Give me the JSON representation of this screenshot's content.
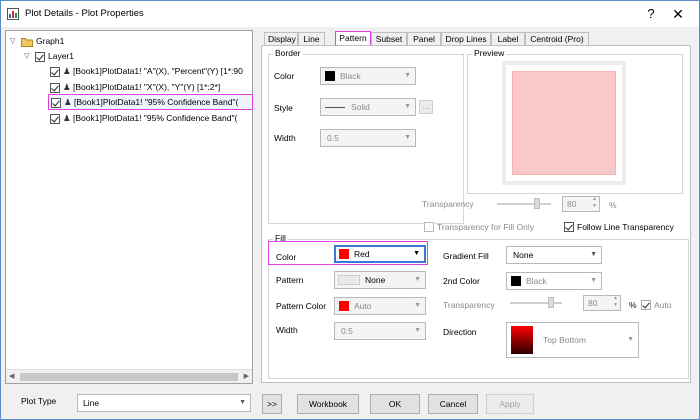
{
  "window": {
    "title": "Plot Details - Plot Properties",
    "help_glyph": "?",
    "close_glyph": "✕"
  },
  "tree": {
    "nodes": [
      {
        "label": "Graph1",
        "icon": "folder-icon",
        "checked": null,
        "expanded": true
      },
      {
        "label": "Layer1",
        "checked": true,
        "expanded": true
      },
      {
        "label": "[Book1]PlotData1! \"A\"(X), \"Percent\"(Y) [1*:90",
        "checked": true
      },
      {
        "label": "[Book1]PlotData1! \"X\"(X), \"Y\"(Y) [1*:2*]",
        "checked": true
      },
      {
        "label": "[Book1]PlotData1! \"95% Confidence Band\"(",
        "checked": true,
        "selected": true
      },
      {
        "label": "[Book1]PlotData1! \"95% Confidence Band\"(",
        "checked": true
      }
    ]
  },
  "tabs": [
    "Display",
    "Line",
    "Pattern",
    "Subset",
    "Panel",
    "Drop Lines",
    "Label",
    "Centroid (Pro)"
  ],
  "active_tab": "Pattern",
  "border": {
    "group_label": "Border",
    "color_label": "Color",
    "color_value": "Black",
    "color_swatch": "#000000",
    "style_label": "Style",
    "style_value": "Solid",
    "width_label": "Width",
    "width_value": "0.5",
    "more_button": "..."
  },
  "preview": {
    "group_label": "Preview",
    "fill_color": "#f9c9c9"
  },
  "transparency": {
    "label": "Transparency",
    "value": "80",
    "unit": "%",
    "fill_only_label": "Transparency for Fill Only",
    "fill_only_checked": false,
    "follow_line_label": "Follow Line Transparency",
    "follow_line_checked": true
  },
  "fill": {
    "group_label": "Fill",
    "color_label": "Color",
    "color_value": "Red",
    "color_swatch": "#ff0000",
    "pattern_label": "Pattern",
    "pattern_value": "None",
    "pattern_color_label": "Pattern Color",
    "pattern_color_value": "Auto",
    "width_label": "Width",
    "width_value": "0.5",
    "gradient_label": "Gradient Fill",
    "gradient_value": "None",
    "second_color_label": "2nd Color",
    "second_color_value": "Black",
    "transparency_label": "Transparency",
    "transparency_value": "80",
    "transparency_unit": "%",
    "auto_label": "Auto",
    "auto_checked": true,
    "direction_label": "Direction",
    "direction_value": "Top Bottom"
  },
  "bottom": {
    "plot_type_label": "Plot Type",
    "plot_type_value": "Line",
    "expand_button": ">>",
    "workbook_button": "Workbook",
    "ok_button": "OK",
    "cancel_button": "Cancel",
    "apply_button": "Apply"
  },
  "colors": {
    "highlight": "#e040e0",
    "accent_blue": "#3c78d8"
  }
}
